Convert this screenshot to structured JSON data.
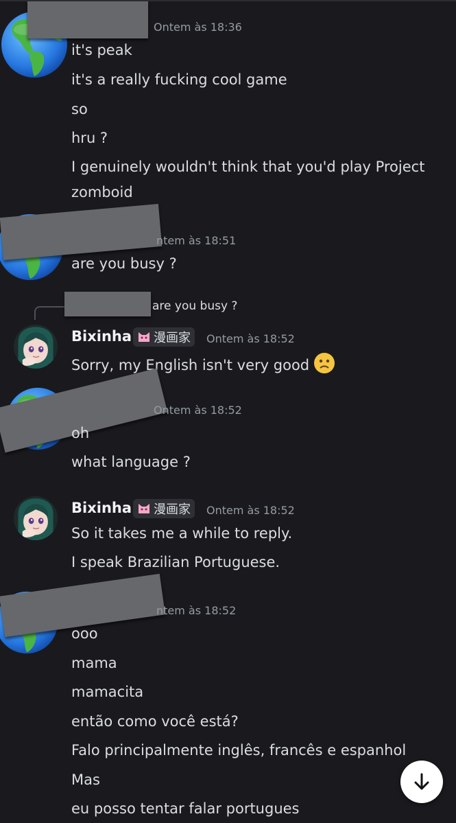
{
  "groups": [
    {
      "timestamp": "Ontem às 18:36",
      "messages": [
        "it's peak",
        "it's a really fucking cool game",
        "so",
        "hru ?",
        "I genuinely wouldn't think that you'd play Project",
        "zomboid"
      ]
    },
    {
      "timestamp": "ntem às 18:51",
      "messages": [
        "are you busy ?"
      ]
    },
    {
      "reply": {
        "text": "are you busy ?"
      },
      "author": "Bixinha",
      "tag": "漫画家",
      "timestamp": "Ontem às 18:52",
      "messages": [
        "Sorry, my English isn't very good"
      ]
    },
    {
      "timestamp": "Ontem às 18:52",
      "messages": [
        "oh",
        "what language ?"
      ]
    },
    {
      "author": "Bixinha",
      "tag": "漫画家",
      "timestamp": "Ontem às 18:52",
      "messages": [
        "So it takes me a while to reply.",
        "I speak Brazilian Portuguese."
      ]
    },
    {
      "timestamp": "ntem às 18:52",
      "messages": [
        "ooo",
        "mama",
        "mamacita",
        "então como você está?",
        "Falo principalmente inglês, francês e espanhol",
        "Mas",
        "eu posso tentar falar portugues"
      ]
    }
  ],
  "colors": {
    "background": "#1a1a1e",
    "text": "#dbdee1",
    "timestamp": "#949ba4",
    "redaction": "#67686b"
  },
  "icons": {
    "avatar_other": "globe-icon",
    "tag_icon": "cat-icon",
    "emoji": "slightly-frowning-face",
    "scroll": "arrow-down-icon"
  }
}
